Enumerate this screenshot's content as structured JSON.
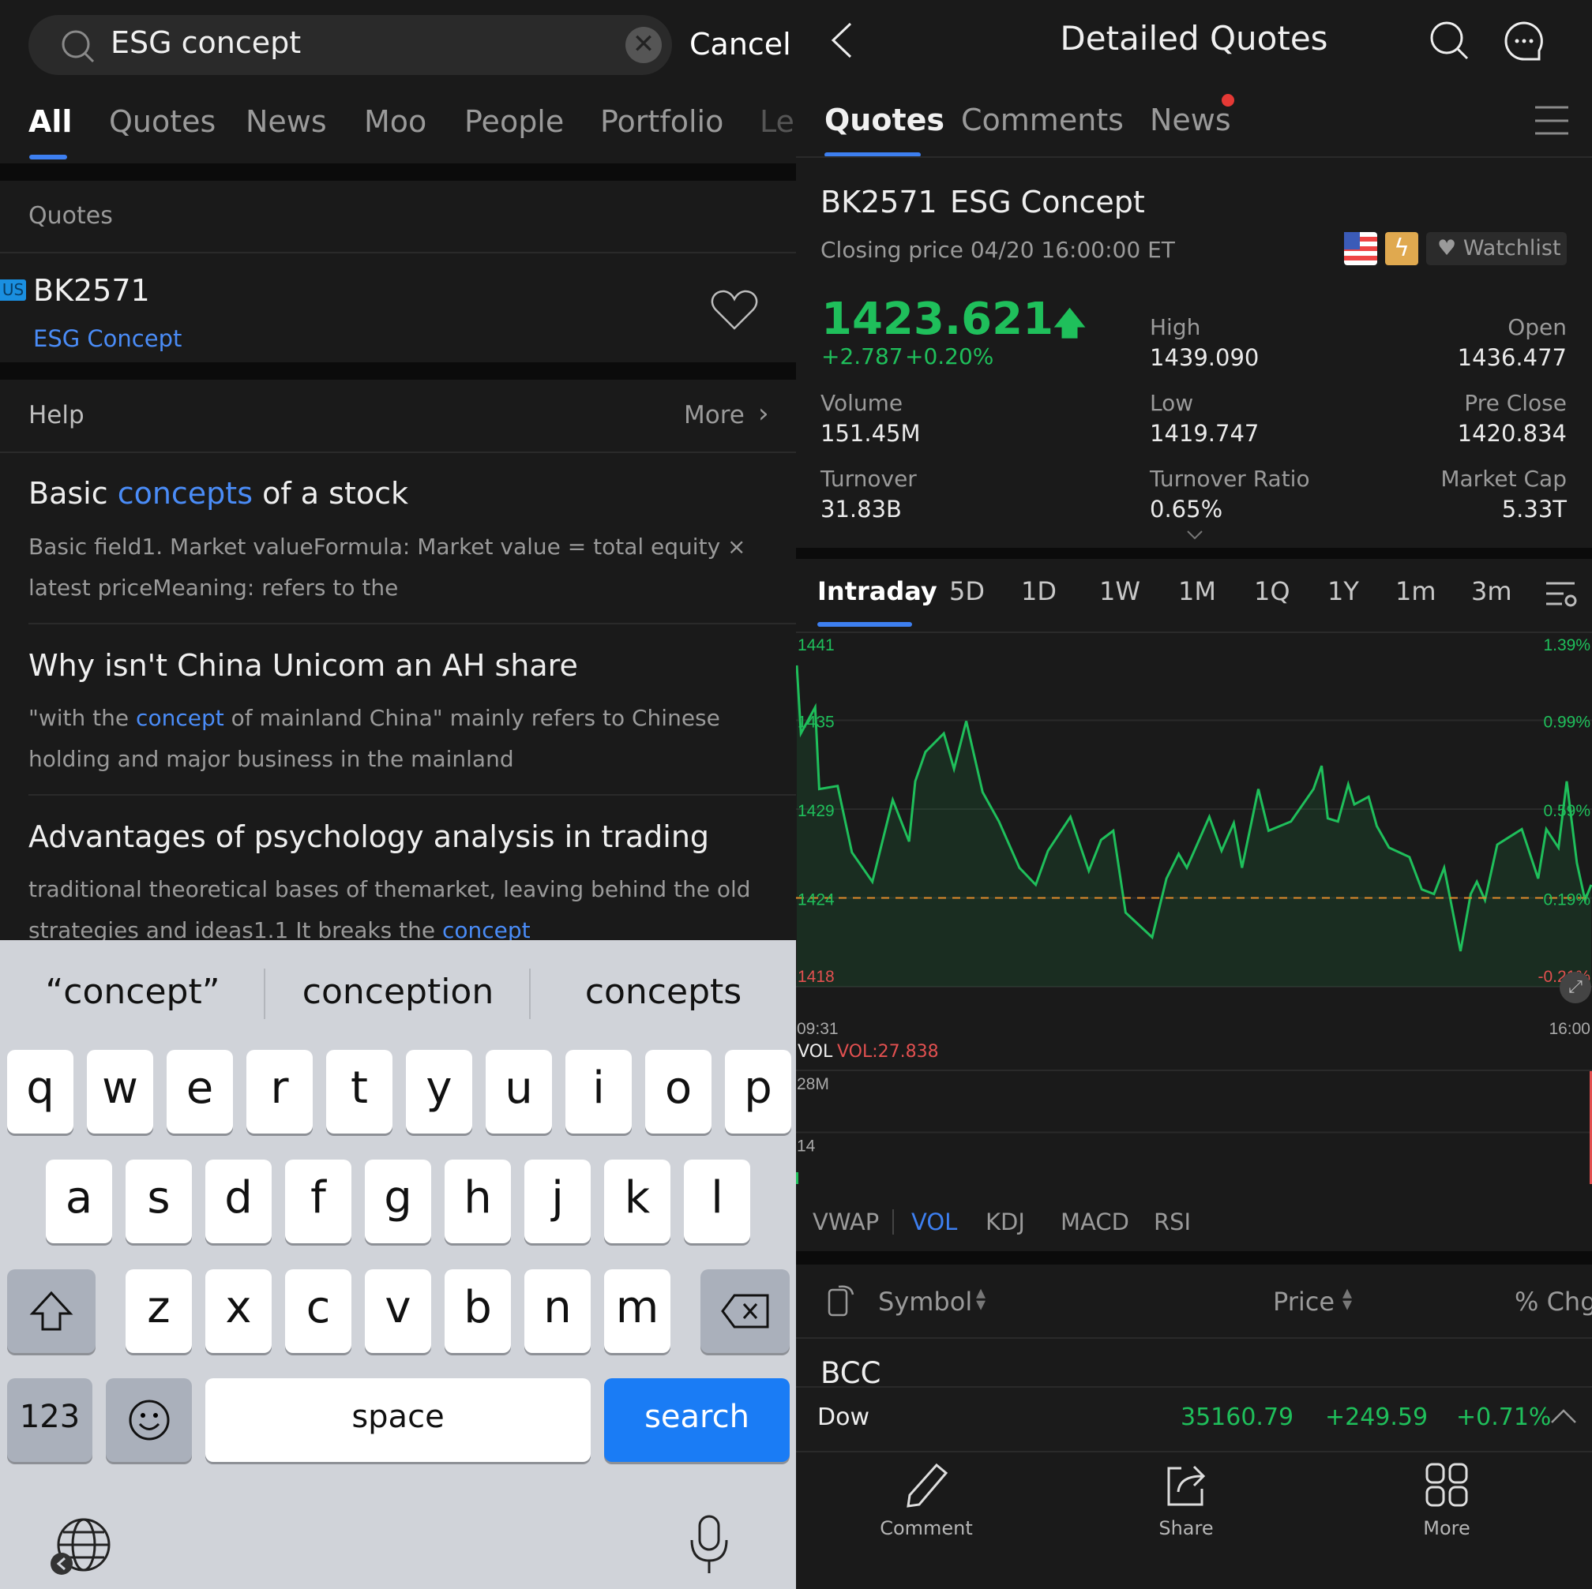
{
  "search": {
    "query": "ESG concept",
    "cancel": "Cancel",
    "tabs": [
      {
        "label": "All",
        "active": true
      },
      {
        "label": "Quotes"
      },
      {
        "label": "News"
      },
      {
        "label": "Moo"
      },
      {
        "label": "People"
      },
      {
        "label": "Portfolio"
      },
      {
        "label": "Le"
      }
    ],
    "quotes_section": "Quotes",
    "result": {
      "market_badge": "US",
      "symbol": "BK2571",
      "name": "ESG Concept"
    },
    "help_section": "Help",
    "more": "More",
    "articles": [
      {
        "title_pre": "Basic ",
        "title_hl": "concepts",
        "title_post": " of a stock",
        "body": "Basic field1. Market valueFormula: Market value = total equity × latest priceMeaning: refers to the"
      },
      {
        "title": "Why isn't China Unicom an AH share",
        "body_pre": "\"with the ",
        "body_hl": "concept",
        "body_post": " of mainland China\" mainly refers to Chinese holding and major business in the mainland"
      },
      {
        "title": "Advantages of psychology analysis in trading",
        "body_pre": "traditional theoretical bases of themarket, leaving behind the old strategies and ideas1.1 It breaks the ",
        "body_hl": "concept"
      }
    ]
  },
  "keyboard": {
    "suggestions": [
      "“concept”",
      "conception",
      "concepts"
    ],
    "row1": [
      "q",
      "w",
      "e",
      "r",
      "t",
      "y",
      "u",
      "i",
      "o",
      "p"
    ],
    "row2": [
      "a",
      "s",
      "d",
      "f",
      "g",
      "h",
      "j",
      "k",
      "l"
    ],
    "row3": [
      "z",
      "x",
      "c",
      "v",
      "b",
      "n",
      "m"
    ],
    "numbers": "123",
    "space": "space",
    "search": "search"
  },
  "detail": {
    "title": "Detailed Quotes",
    "tabs": [
      {
        "label": "Quotes",
        "active": true
      },
      {
        "label": "Comments"
      },
      {
        "label": "News",
        "badge": true
      }
    ],
    "symbol": "BK2571",
    "name": "ESG Concept",
    "closing": "Closing price 04/20 16:00:00 ET",
    "watchlist": "Watchlist",
    "price": "1423.621",
    "change": "+2.787",
    "change_pct": "+0.20%",
    "stats": [
      {
        "label": "High",
        "value": "1439.090"
      },
      {
        "label": "Open",
        "value": "1436.477"
      },
      {
        "label": "Volume",
        "value": "151.45M"
      },
      {
        "label": "Low",
        "value": "1419.747"
      },
      {
        "label": "Pre Close",
        "value": "1420.834"
      },
      {
        "label": "Turnover",
        "value": "31.83B"
      },
      {
        "label": "Turnover Ratio",
        "value": "0.65%"
      },
      {
        "label": "Market Cap",
        "value": "5.33T"
      }
    ],
    "chart_tabs": [
      {
        "label": "Intraday",
        "active": true
      },
      {
        "label": "5D"
      },
      {
        "label": "1D"
      },
      {
        "label": "1W"
      },
      {
        "label": "1M"
      },
      {
        "label": "1Q"
      },
      {
        "label": "1Y"
      },
      {
        "label": "1m"
      },
      {
        "label": "3m"
      }
    ],
    "indicator_tabs": [
      {
        "label": "VWAP"
      },
      {
        "label": "VOL",
        "active": true
      },
      {
        "label": "KDJ"
      },
      {
        "label": "MACD"
      },
      {
        "label": "RSI"
      }
    ],
    "vol_label": "VOL",
    "vol_value": "VOL:27.838",
    "table": {
      "symbol": "Symbol",
      "price": "Price",
      "chg": "% Chg",
      "first_row": "BCC"
    },
    "ticker": {
      "name": "Dow",
      "price": "35160.79",
      "change": "+249.59",
      "pct": "+0.71%"
    },
    "nav": [
      {
        "label": "Comment"
      },
      {
        "label": "Share"
      },
      {
        "label": "More"
      }
    ]
  },
  "colors": {
    "up": "#1fbf5b",
    "down": "#e25050",
    "accent": "#3d7ff0",
    "ref_line": "#e08a2c"
  },
  "chart_data": {
    "type": "area",
    "x": [
      "09:31",
      "09:33",
      "09:40",
      "09:42",
      "09:51",
      "09:58",
      "10:08",
      "10:18",
      "10:26",
      "10:29",
      "10:34",
      "10:43",
      "10:48",
      "10:54",
      "11:02",
      "11:10",
      "11:20",
      "11:28",
      "11:34",
      "11:45",
      "11:54",
      "12:00",
      "12:06",
      "12:12",
      "12:25",
      "12:32",
      "12:38",
      "12:42",
      "12:53",
      "12:59",
      "13:05",
      "13:09",
      "13:17",
      "13:22",
      "13:33",
      "13:44",
      "13:48",
      "13:51",
      "13:56",
      "14:01",
      "14:04",
      "14:11",
      "14:15",
      "14:21",
      "14:31",
      "14:37",
      "14:43",
      "14:48",
      "14:56",
      "15:01",
      "15:04",
      "15:08",
      "15:14",
      "15:26",
      "15:34",
      "15:38",
      "15:44",
      "15:48",
      "15:53",
      "15:57",
      "16:00"
    ],
    "y": [
      1438.8,
      1434.4,
      1436.1,
      1430.8,
      1431,
      1426.7,
      1424.8,
      1430.1,
      1427.4,
      1431.3,
      1433.2,
      1434.4,
      1432.1,
      1435.2,
      1430.6,
      1428.7,
      1425.7,
      1424.6,
      1426.8,
      1429,
      1425.5,
      1427.5,
      1428.1,
      1422.8,
      1421.2,
      1425,
      1426.6,
      1425.7,
      1429,
      1426.8,
      1428.6,
      1425.7,
      1430.8,
      1428.1,
      1428.7,
      1430.8,
      1432.3,
      1428.9,
      1428.7,
      1431.1,
      1429.8,
      1430.3,
      1428.4,
      1427,
      1426.4,
      1424.3,
      1424,
      1425.7,
      1420.3,
      1424,
      1424.8,
      1423.6,
      1427.2,
      1428.2,
      1425,
      1428.2,
      1427,
      1431.3,
      1426,
      1423.6,
      1424.6
    ],
    "ylim": [
      1418,
      1441
    ],
    "y_ticks": [
      "1441",
      "1435",
      "1429",
      "1424",
      "1418"
    ],
    "y2_ticks": [
      "1.39%",
      "0.99%",
      "0.59%",
      "0.19%",
      "-0.21%"
    ],
    "x_ticks": [
      "09:31",
      "16:00"
    ],
    "reference_line": 1423.75,
    "volume": {
      "ticks": [
        "28M",
        "14"
      ],
      "ylim": [
        0,
        28
      ],
      "last": 27.838,
      "first": 5
    }
  }
}
